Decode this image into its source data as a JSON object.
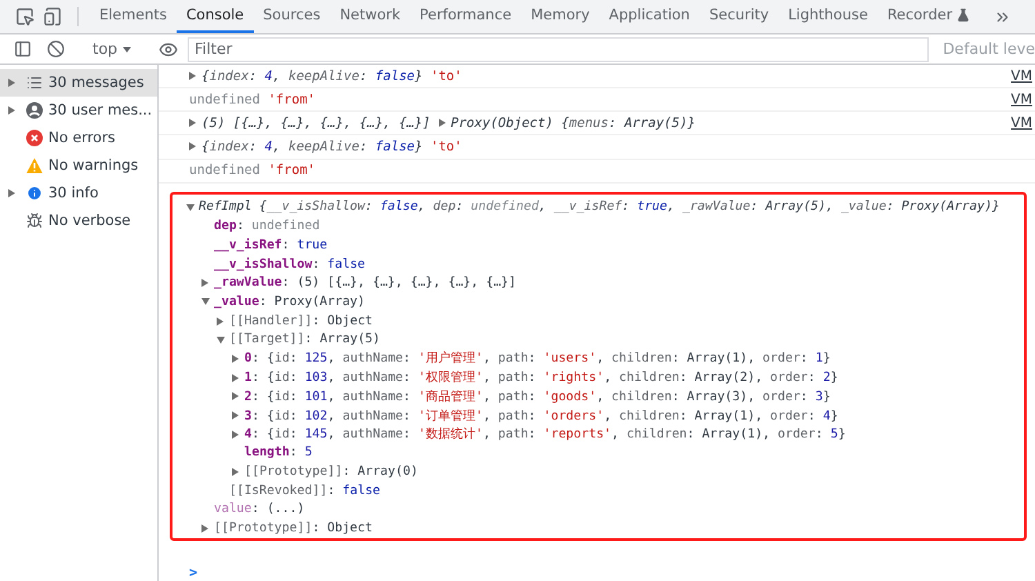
{
  "tabs": [
    {
      "label": "Elements",
      "selected": false
    },
    {
      "label": "Console",
      "selected": true
    },
    {
      "label": "Sources",
      "selected": false
    },
    {
      "label": "Network",
      "selected": false
    },
    {
      "label": "Performance",
      "selected": false
    },
    {
      "label": "Memory",
      "selected": false
    },
    {
      "label": "Application",
      "selected": false
    },
    {
      "label": "Security",
      "selected": false
    },
    {
      "label": "Lighthouse",
      "selected": false
    },
    {
      "label": "Recorder",
      "selected": false,
      "kind": "experimental"
    }
  ],
  "toolbar": {
    "context": "top",
    "filter": {
      "placeholder": "Filter"
    },
    "levels": "Default leve"
  },
  "sidebar": {
    "items": [
      {
        "label": "30 messages",
        "kind": "list",
        "expanded": false,
        "selected": true
      },
      {
        "label": "30 user mes...",
        "kind": "user",
        "expanded": false,
        "selected": false
      },
      {
        "label": "No errors",
        "kind": "error",
        "selected": false
      },
      {
        "label": "No warnings",
        "kind": "warning",
        "selected": false
      },
      {
        "label": "30 info",
        "kind": "info",
        "expanded": false,
        "selected": false
      },
      {
        "label": "No verbose",
        "kind": "bug",
        "selected": false
      }
    ]
  },
  "console": {
    "entries": [
      {
        "source": "VM",
        "segments": [
          {
            "kind": "arrow",
            "expanded": false
          },
          {
            "kind": "i-text",
            "text": "{"
          },
          {
            "kind": "i-key",
            "text": "index"
          },
          {
            "kind": "i-text",
            "text": ": "
          },
          {
            "kind": "i-number",
            "text": "4"
          },
          {
            "kind": "i-text",
            "text": ", "
          },
          {
            "kind": "i-key",
            "text": "keepAlive"
          },
          {
            "kind": "i-text",
            "text": ": "
          },
          {
            "kind": "i-bool",
            "text": "false"
          },
          {
            "kind": "i-text",
            "text": "} "
          },
          {
            "kind": "string",
            "text": "'to'"
          }
        ]
      },
      {
        "source": "VM",
        "segments": [
          {
            "kind": "undef",
            "text": "undefined "
          },
          {
            "kind": "string",
            "text": "'from'"
          }
        ]
      },
      {
        "source": "VM",
        "segments": [
          {
            "kind": "arrow",
            "expanded": false
          },
          {
            "kind": "i-text",
            "text": "(5) [{…}, {…}, {…}, {…}, {…}] "
          },
          {
            "kind": "arrow",
            "expanded": false
          },
          {
            "kind": "i-text",
            "text": "Proxy(Object) {"
          },
          {
            "kind": "i-key",
            "text": "menus"
          },
          {
            "kind": "i-text",
            "text": ": Array(5)}"
          }
        ]
      },
      {
        "segments": [
          {
            "kind": "arrow",
            "expanded": false
          },
          {
            "kind": "i-text",
            "text": "{"
          },
          {
            "kind": "i-key",
            "text": "index"
          },
          {
            "kind": "i-text",
            "text": ": "
          },
          {
            "kind": "i-number",
            "text": "4"
          },
          {
            "kind": "i-text",
            "text": ", "
          },
          {
            "kind": "i-key",
            "text": "keepAlive"
          },
          {
            "kind": "i-text",
            "text": ": "
          },
          {
            "kind": "i-bool",
            "text": "false"
          },
          {
            "kind": "i-text",
            "text": "} "
          },
          {
            "kind": "string",
            "text": "'to'"
          }
        ]
      },
      {
        "segments": [
          {
            "kind": "undef",
            "text": "undefined "
          },
          {
            "kind": "string",
            "text": "'from'"
          }
        ]
      },
      {
        "highlighted": true,
        "tree": {
          "expanded": true,
          "segments": [
            {
              "kind": "i-text",
              "text": "RefImpl {"
            },
            {
              "kind": "i-key",
              "text": "__v_isShallow"
            },
            {
              "kind": "i-text",
              "text": ": "
            },
            {
              "kind": "i-bool",
              "text": "false"
            },
            {
              "kind": "i-text",
              "text": ", "
            },
            {
              "kind": "i-key",
              "text": "dep"
            },
            {
              "kind": "i-text",
              "text": ": "
            },
            {
              "kind": "i-undef",
              "text": "undefined"
            },
            {
              "kind": "i-text",
              "text": ", "
            },
            {
              "kind": "i-key",
              "text": "__v_isRef"
            },
            {
              "kind": "i-text",
              "text": ": "
            },
            {
              "kind": "i-bool",
              "text": "true"
            },
            {
              "kind": "i-text",
              "text": ", "
            },
            {
              "kind": "i-key",
              "text": "_rawValue"
            },
            {
              "kind": "i-text",
              "text": ": Array(5), "
            },
            {
              "kind": "i-key",
              "text": "_value"
            },
            {
              "kind": "i-text",
              "text": ": Proxy(Array)}"
            }
          ],
          "children": [
            {
              "segments": [
                {
                  "kind": "key",
                  "text": "dep"
                },
                {
                  "kind": "text",
                  "text": ": "
                },
                {
                  "kind": "undef",
                  "text": "undefined"
                }
              ]
            },
            {
              "segments": [
                {
                  "kind": "key",
                  "text": "__v_isRef"
                },
                {
                  "kind": "text",
                  "text": ": "
                },
                {
                  "kind": "bool",
                  "text": "true"
                }
              ]
            },
            {
              "segments": [
                {
                  "kind": "key",
                  "text": "__v_isShallow"
                },
                {
                  "kind": "text",
                  "text": ": "
                },
                {
                  "kind": "bool",
                  "text": "false"
                }
              ]
            },
            {
              "expanded": false,
              "segments": [
                {
                  "kind": "key",
                  "text": "_rawValue"
                },
                {
                  "kind": "text",
                  "text": ": (5) [{…}, {…}, {…}, {…}, {…}]"
                }
              ]
            },
            {
              "expanded": true,
              "segments": [
                {
                  "kind": "key",
                  "text": "_value"
                },
                {
                  "kind": "text",
                  "text": ": Proxy(Array)"
                }
              ],
              "children": [
                {
                  "expanded": false,
                  "segments": [
                    {
                      "kind": "internal",
                      "text": "[[Handler]]"
                    },
                    {
                      "kind": "text",
                      "text": ": Object"
                    }
                  ]
                },
                {
                  "expanded": true,
                  "segments": [
                    {
                      "kind": "internal",
                      "text": "[[Target]]"
                    },
                    {
                      "kind": "text",
                      "text": ": Array(5)"
                    }
                  ],
                  "children": [
                    {
                      "expanded": false,
                      "segments": [
                        {
                          "kind": "key",
                          "text": "0"
                        },
                        {
                          "kind": "text",
                          "text": ": {"
                        },
                        {
                          "kind": "pkey",
                          "text": "id"
                        },
                        {
                          "kind": "text",
                          "text": ": "
                        },
                        {
                          "kind": "number",
                          "text": "125"
                        },
                        {
                          "kind": "text",
                          "text": ", "
                        },
                        {
                          "kind": "pkey",
                          "text": "authName"
                        },
                        {
                          "kind": "text",
                          "text": ": "
                        },
                        {
                          "kind": "string",
                          "text": "'用户管理'"
                        },
                        {
                          "kind": "text",
                          "text": ", "
                        },
                        {
                          "kind": "pkey",
                          "text": "path"
                        },
                        {
                          "kind": "text",
                          "text": ": "
                        },
                        {
                          "kind": "string",
                          "text": "'users'"
                        },
                        {
                          "kind": "text",
                          "text": ", "
                        },
                        {
                          "kind": "pkey",
                          "text": "children"
                        },
                        {
                          "kind": "text",
                          "text": ": Array(1), "
                        },
                        {
                          "kind": "pkey",
                          "text": "order"
                        },
                        {
                          "kind": "text",
                          "text": ": "
                        },
                        {
                          "kind": "number",
                          "text": "1"
                        },
                        {
                          "kind": "text",
                          "text": "}"
                        }
                      ]
                    },
                    {
                      "expanded": false,
                      "segments": [
                        {
                          "kind": "key",
                          "text": "1"
                        },
                        {
                          "kind": "text",
                          "text": ": {"
                        },
                        {
                          "kind": "pkey",
                          "text": "id"
                        },
                        {
                          "kind": "text",
                          "text": ": "
                        },
                        {
                          "kind": "number",
                          "text": "103"
                        },
                        {
                          "kind": "text",
                          "text": ", "
                        },
                        {
                          "kind": "pkey",
                          "text": "authName"
                        },
                        {
                          "kind": "text",
                          "text": ": "
                        },
                        {
                          "kind": "string",
                          "text": "'权限管理'"
                        },
                        {
                          "kind": "text",
                          "text": ", "
                        },
                        {
                          "kind": "pkey",
                          "text": "path"
                        },
                        {
                          "kind": "text",
                          "text": ": "
                        },
                        {
                          "kind": "string",
                          "text": "'rights'"
                        },
                        {
                          "kind": "text",
                          "text": ", "
                        },
                        {
                          "kind": "pkey",
                          "text": "children"
                        },
                        {
                          "kind": "text",
                          "text": ": Array(2), "
                        },
                        {
                          "kind": "pkey",
                          "text": "order"
                        },
                        {
                          "kind": "text",
                          "text": ": "
                        },
                        {
                          "kind": "number",
                          "text": "2"
                        },
                        {
                          "kind": "text",
                          "text": "}"
                        }
                      ]
                    },
                    {
                      "expanded": false,
                      "segments": [
                        {
                          "kind": "key",
                          "text": "2"
                        },
                        {
                          "kind": "text",
                          "text": ": {"
                        },
                        {
                          "kind": "pkey",
                          "text": "id"
                        },
                        {
                          "kind": "text",
                          "text": ": "
                        },
                        {
                          "kind": "number",
                          "text": "101"
                        },
                        {
                          "kind": "text",
                          "text": ", "
                        },
                        {
                          "kind": "pkey",
                          "text": "authName"
                        },
                        {
                          "kind": "text",
                          "text": ": "
                        },
                        {
                          "kind": "string",
                          "text": "'商品管理'"
                        },
                        {
                          "kind": "text",
                          "text": ", "
                        },
                        {
                          "kind": "pkey",
                          "text": "path"
                        },
                        {
                          "kind": "text",
                          "text": ": "
                        },
                        {
                          "kind": "string",
                          "text": "'goods'"
                        },
                        {
                          "kind": "text",
                          "text": ", "
                        },
                        {
                          "kind": "pkey",
                          "text": "children"
                        },
                        {
                          "kind": "text",
                          "text": ": Array(3), "
                        },
                        {
                          "kind": "pkey",
                          "text": "order"
                        },
                        {
                          "kind": "text",
                          "text": ": "
                        },
                        {
                          "kind": "number",
                          "text": "3"
                        },
                        {
                          "kind": "text",
                          "text": "}"
                        }
                      ]
                    },
                    {
                      "expanded": false,
                      "segments": [
                        {
                          "kind": "key",
                          "text": "3"
                        },
                        {
                          "kind": "text",
                          "text": ": {"
                        },
                        {
                          "kind": "pkey",
                          "text": "id"
                        },
                        {
                          "kind": "text",
                          "text": ": "
                        },
                        {
                          "kind": "number",
                          "text": "102"
                        },
                        {
                          "kind": "text",
                          "text": ", "
                        },
                        {
                          "kind": "pkey",
                          "text": "authName"
                        },
                        {
                          "kind": "text",
                          "text": ": "
                        },
                        {
                          "kind": "string",
                          "text": "'订单管理'"
                        },
                        {
                          "kind": "text",
                          "text": ", "
                        },
                        {
                          "kind": "pkey",
                          "text": "path"
                        },
                        {
                          "kind": "text",
                          "text": ": "
                        },
                        {
                          "kind": "string",
                          "text": "'orders'"
                        },
                        {
                          "kind": "text",
                          "text": ", "
                        },
                        {
                          "kind": "pkey",
                          "text": "children"
                        },
                        {
                          "kind": "text",
                          "text": ": Array(1), "
                        },
                        {
                          "kind": "pkey",
                          "text": "order"
                        },
                        {
                          "kind": "text",
                          "text": ": "
                        },
                        {
                          "kind": "number",
                          "text": "4"
                        },
                        {
                          "kind": "text",
                          "text": "}"
                        }
                      ]
                    },
                    {
                      "expanded": false,
                      "segments": [
                        {
                          "kind": "key",
                          "text": "4"
                        },
                        {
                          "kind": "text",
                          "text": ": {"
                        },
                        {
                          "kind": "pkey",
                          "text": "id"
                        },
                        {
                          "kind": "text",
                          "text": ": "
                        },
                        {
                          "kind": "number",
                          "text": "145"
                        },
                        {
                          "kind": "text",
                          "text": ", "
                        },
                        {
                          "kind": "pkey",
                          "text": "authName"
                        },
                        {
                          "kind": "text",
                          "text": ": "
                        },
                        {
                          "kind": "string",
                          "text": "'数据统计'"
                        },
                        {
                          "kind": "text",
                          "text": ", "
                        },
                        {
                          "kind": "pkey",
                          "text": "path"
                        },
                        {
                          "kind": "text",
                          "text": ": "
                        },
                        {
                          "kind": "string",
                          "text": "'reports'"
                        },
                        {
                          "kind": "text",
                          "text": ", "
                        },
                        {
                          "kind": "pkey",
                          "text": "children"
                        },
                        {
                          "kind": "text",
                          "text": ": Array(1), "
                        },
                        {
                          "kind": "pkey",
                          "text": "order"
                        },
                        {
                          "kind": "text",
                          "text": ": "
                        },
                        {
                          "kind": "number",
                          "text": "5"
                        },
                        {
                          "kind": "text",
                          "text": "}"
                        }
                      ]
                    },
                    {
                      "segments": [
                        {
                          "kind": "key",
                          "text": "length"
                        },
                        {
                          "kind": "text",
                          "text": ": "
                        },
                        {
                          "kind": "number",
                          "text": "5"
                        }
                      ]
                    },
                    {
                      "expanded": false,
                      "segments": [
                        {
                          "kind": "internal",
                          "text": "[[Prototype]]"
                        },
                        {
                          "kind": "text",
                          "text": ": Array(0)"
                        }
                      ]
                    }
                  ]
                },
                {
                  "segments": [
                    {
                      "kind": "internal",
                      "text": "[[IsRevoked]]"
                    },
                    {
                      "kind": "text",
                      "text": ": "
                    },
                    {
                      "kind": "bool",
                      "text": "false"
                    }
                  ]
                }
              ]
            },
            {
              "segments": [
                {
                  "kind": "getter",
                  "text": "value"
                },
                {
                  "kind": "text",
                  "text": ": (...)"
                }
              ]
            },
            {
              "expanded": false,
              "segments": [
                {
                  "kind": "internal",
                  "text": "[[Prototype]]"
                },
                {
                  "kind": "text",
                  "text": ": Object"
                }
              ]
            }
          ]
        }
      }
    ],
    "prompt": ">"
  }
}
